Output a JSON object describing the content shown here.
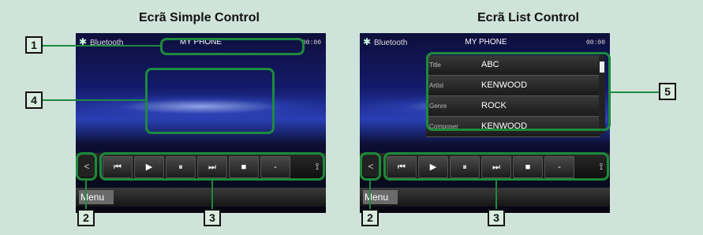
{
  "left": {
    "title": "Ecrã Simple Control",
    "source_label": "Bluetooth",
    "device_name": "MY PHONE",
    "clock": "00:00",
    "menu_label": "Menu"
  },
  "right": {
    "title": "Ecrã List Control",
    "source_label": "Bluetooth",
    "device_name": "MY PHONE",
    "clock": "00:00",
    "menu_label": "Menu",
    "list": [
      {
        "key": "Title",
        "value": "ABC"
      },
      {
        "key": "Artist",
        "value": "KENWOOD"
      },
      {
        "key": "Genre",
        "value": "ROCK"
      },
      {
        "key": "Composer",
        "value": "KENWOOD"
      }
    ]
  },
  "controls": {
    "back": "<",
    "prev": "⏮",
    "play": "▶",
    "pause": "⏸",
    "next": "⏭",
    "stop": "■",
    "minus": "-",
    "antenna": "⟟"
  },
  "callouts": {
    "c1": "1",
    "c2_left": "2",
    "c3_left": "3",
    "c4": "4",
    "c5": "5",
    "c2_right": "2",
    "c3_right": "3"
  },
  "accent_color": "#1d8a3c",
  "icons": {
    "bluetooth": "bluetooth-icon",
    "back": "back-arrow-icon",
    "prev": "previous-track-icon",
    "play": "play-icon",
    "pause": "pause-icon",
    "next": "next-track-icon",
    "stop": "stop-icon",
    "antenna": "antenna-icon"
  }
}
